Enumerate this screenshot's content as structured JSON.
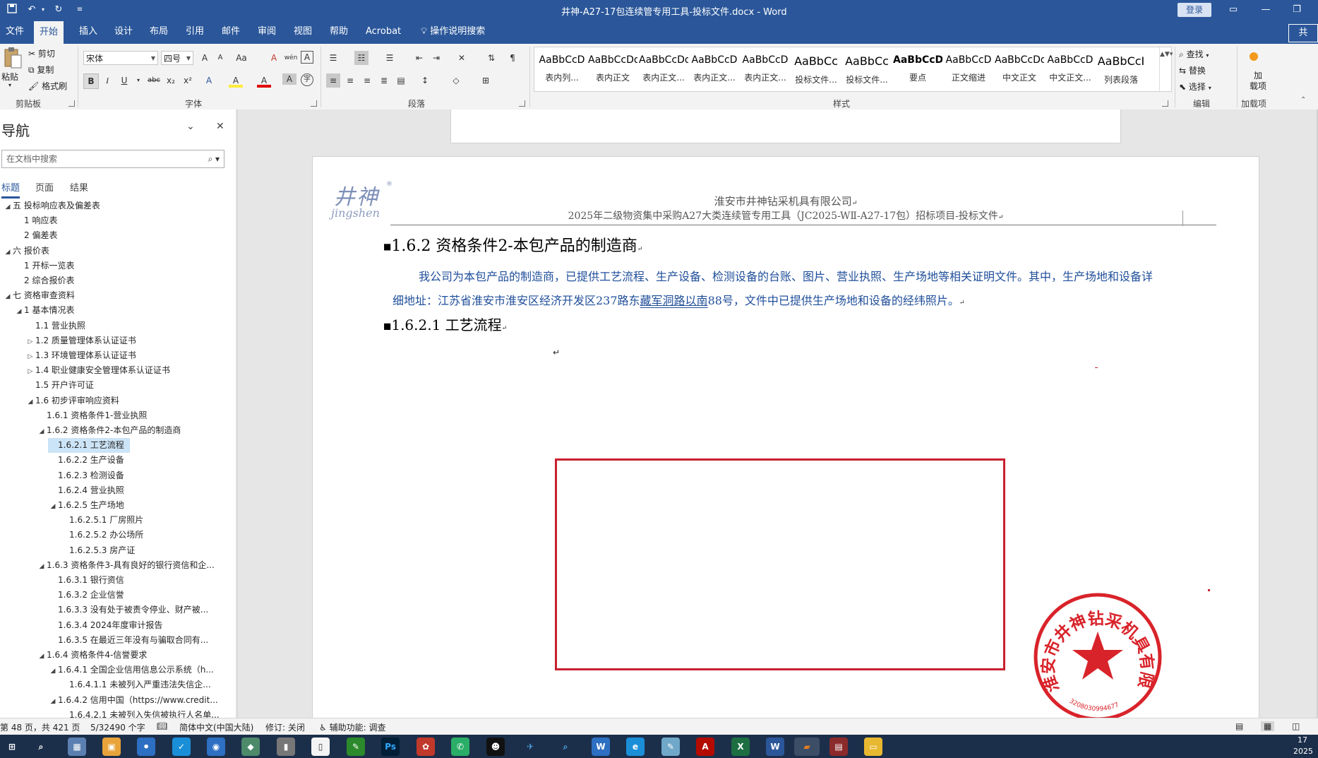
{
  "window": {
    "title": "井神-A27-17包连续管专用工具-投标文件.docx  -  Word",
    "login": "登录"
  },
  "ribbon_tabs": [
    "文件",
    "开始",
    "插入",
    "设计",
    "布局",
    "引用",
    "邮件",
    "审阅",
    "视图",
    "帮助",
    "Acrobat"
  ],
  "tell_me": "操作说明搜索",
  "share": "共",
  "ribbon": {
    "clipboard": {
      "paste": "粘贴",
      "cut": "剪切",
      "copy": "复制",
      "format_painter": "格式刷",
      "label": "剪贴板"
    },
    "font": {
      "name": "宋体",
      "size": "四号",
      "label": "字体",
      "case": "Aa",
      "bold": "B",
      "italic": "I",
      "underline": "U",
      "strike": "abc",
      "sub": "x₂",
      "sup": "x²",
      "font_color": "A",
      "highlight": "A",
      "effects": "A",
      "char_shade": "A",
      "enclose": "字",
      "grow": "A",
      "shrink": "A",
      "clear": "A",
      "pinyin": "wén",
      "border": "A"
    },
    "paragraph": {
      "label": "段落"
    },
    "styles": {
      "label": "样式",
      "items": [
        {
          "preview": "AaBbCcD",
          "name": "表内列..."
        },
        {
          "preview": "AaBbCcDdI",
          "name": "表内正文"
        },
        {
          "preview": "AaBbCcDdI",
          "name": "表内正文..."
        },
        {
          "preview": "AaBbCcD",
          "name": "表内正文..."
        },
        {
          "preview": "AaBbCcD",
          "name": "表内正文..."
        },
        {
          "preview": "AaBbCc",
          "name": "投标文件..."
        },
        {
          "preview": "AaBbCc",
          "name": "投标文件..."
        },
        {
          "preview": "AaBbCcD",
          "name": "要点"
        },
        {
          "preview": "AaBbCcD",
          "name": "正文缩进"
        },
        {
          "preview": "AaBbCcDdI",
          "name": "中文正文"
        },
        {
          "preview": "AaBbCcD",
          "name": "中文正文..."
        },
        {
          "preview": "AaBbCcI",
          "name": "列表段落"
        }
      ]
    },
    "editing": {
      "find": "查找",
      "replace": "替换",
      "select": "选择",
      "label": "编辑"
    },
    "addins": {
      "button": "加\n载项",
      "label": "加载项"
    }
  },
  "nav": {
    "title": "导航",
    "search_placeholder": "在文档中搜索",
    "tabs": [
      "标题",
      "页面",
      "结果"
    ],
    "items": [
      {
        "level": 0,
        "toggle": "◢",
        "text": "五 投标响应表及偏差表"
      },
      {
        "level": 1,
        "toggle": "",
        "text": "1 响应表"
      },
      {
        "level": 1,
        "toggle": "",
        "text": "2 偏差表"
      },
      {
        "level": 0,
        "toggle": "◢",
        "text": "六 报价表"
      },
      {
        "level": 1,
        "toggle": "",
        "text": "1 开标一览表"
      },
      {
        "level": 1,
        "toggle": "",
        "text": "2 综合报价表"
      },
      {
        "level": 0,
        "toggle": "◢",
        "text": "七 资格审查资料"
      },
      {
        "level": 1,
        "toggle": "◢",
        "text": "1 基本情况表"
      },
      {
        "level": 2,
        "toggle": "",
        "text": "1.1 营业执照"
      },
      {
        "level": 2,
        "toggle": "▷",
        "text": "1.2 质量管理体系认证证书"
      },
      {
        "level": 2,
        "toggle": "▷",
        "text": "1.3 环境管理体系认证证书"
      },
      {
        "level": 2,
        "toggle": "▷",
        "text": "1.4 职业健康安全管理体系认证证书"
      },
      {
        "level": 2,
        "toggle": "",
        "text": "1.5 开户许可证"
      },
      {
        "level": 2,
        "toggle": "◢",
        "text": "1.6 初步评审响应资料"
      },
      {
        "level": 3,
        "toggle": "",
        "text": "1.6.1 资格条件1-营业执照"
      },
      {
        "level": 3,
        "toggle": "◢",
        "text": "1.6.2 资格条件2-本包产品的制造商"
      },
      {
        "level": 4,
        "toggle": "",
        "text": "1.6.2.1 工艺流程",
        "selected": true
      },
      {
        "level": 4,
        "toggle": "",
        "text": "1.6.2.2 生产设备"
      },
      {
        "level": 4,
        "toggle": "",
        "text": "1.6.2.3 检测设备"
      },
      {
        "level": 4,
        "toggle": "",
        "text": "1.6.2.4 营业执照"
      },
      {
        "level": 4,
        "toggle": "◢",
        "text": "1.6.2.5 生产场地"
      },
      {
        "level": 5,
        "toggle": "",
        "text": "1.6.2.5.1 厂房照片"
      },
      {
        "level": 5,
        "toggle": "",
        "text": "1.6.2.5.2 办公场所"
      },
      {
        "level": 5,
        "toggle": "",
        "text": "1.6.2.5.3 房产证"
      },
      {
        "level": 3,
        "toggle": "◢",
        "text": "1.6.3 资格条件3-具有良好的银行资信和企..."
      },
      {
        "level": 4,
        "toggle": "",
        "text": "1.6.3.1 银行资信"
      },
      {
        "level": 4,
        "toggle": "",
        "text": "1.6.3.2 企业信誉"
      },
      {
        "level": 4,
        "toggle": "",
        "text": "1.6.3.3 没有处于被责令停业、财产被..."
      },
      {
        "level": 4,
        "toggle": "",
        "text": "1.6.3.4 2024年度审计报告"
      },
      {
        "level": 4,
        "toggle": "",
        "text": "1.6.3.5 在最近三年没有与骗取合同有..."
      },
      {
        "level": 3,
        "toggle": "◢",
        "text": "1.6.4 资格条件4-信誉要求"
      },
      {
        "level": 4,
        "toggle": "◢",
        "text": "1.6.4.1 全国企业信用信息公示系统（h..."
      },
      {
        "level": 5,
        "toggle": "",
        "text": "1.6.4.1.1 未被列入严重违法失信企..."
      },
      {
        "level": 4,
        "toggle": "◢",
        "text": "1.6.4.2 信用中国（https://www.credit..."
      },
      {
        "level": 5,
        "toggle": "",
        "text": "1.6.4.2.1 未被列入失信被执行人名单..."
      }
    ]
  },
  "document": {
    "logo_text": "井神",
    "logo_sub": "jingshen",
    "header_line1": "淮安市井神钻采机具有限公司",
    "header_line2": "2025年二级物资集中采购A27大类连续管专用工具（JC2025-WⅡ-A27-17包）招标项目-投标文件",
    "heading1": "1.6.2 资格条件2-本包产品的制造商",
    "para_line1": "我公司为本包产品的制造商，已提供工艺流程、生产设备、检测设备的台账、图片、营业执照、生产场地等相关证明文件。其中，生产场地和设备详",
    "para_line2a": "细地址：江苏省淮安市淮安区经济开发区237路东",
    "para_line2b": "藏军洞路以南",
    "para_line2c": "88号，文件中已提供生产场地和设备的经纬照片。",
    "heading2": "1.6.2.1 工艺流程",
    "para_mark": "↵",
    "seal_text": "淮安市井神钻采机具有限公司",
    "seal_number": "3208030994677"
  },
  "status": {
    "page": "第 48 页，共 421 页",
    "words": "5/32490 个字",
    "language": "简体中文(中国大陆)",
    "track": "修订: 关闭",
    "accessibility": "辅助功能: 调查"
  },
  "taskbar": {
    "clock_time": "17",
    "clock_date": "2025"
  },
  "colors": {
    "word_blue": "#2b579a",
    "body_text_blue": "#1f4e9a",
    "seal_red": "#d9232a",
    "box_red": "#c8202f",
    "nav_selected": "#cce4f7"
  }
}
